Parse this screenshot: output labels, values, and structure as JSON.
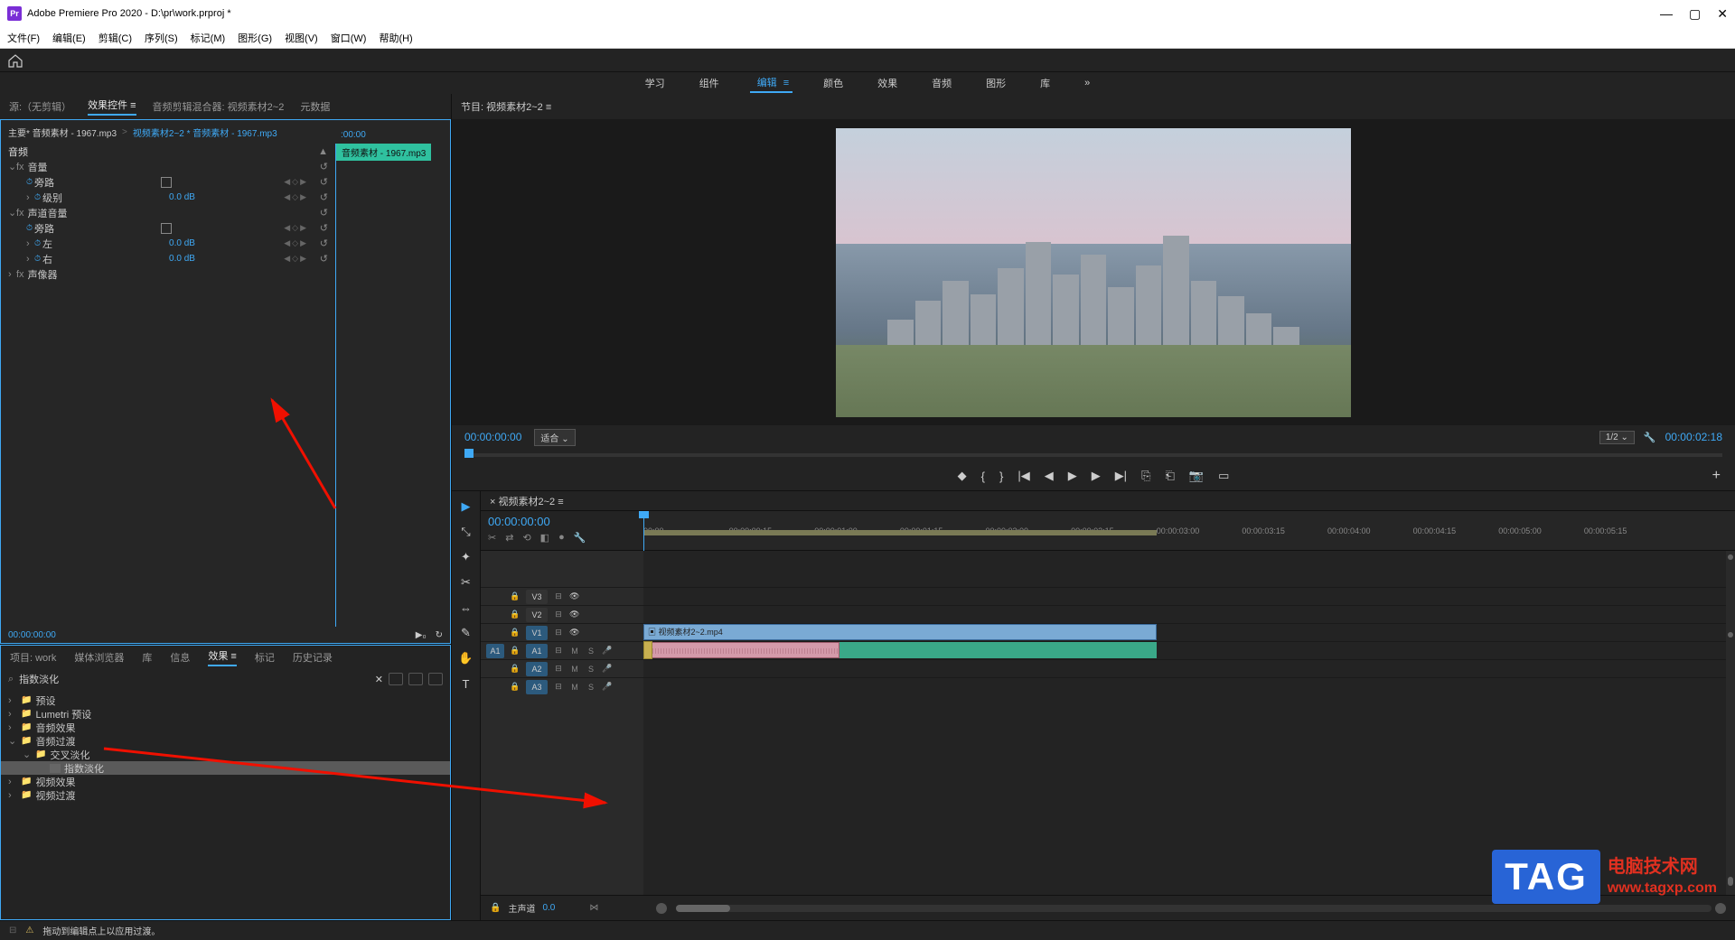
{
  "app": {
    "title": "Adobe Premiere Pro 2020 - D:\\pr\\work.prproj *"
  },
  "win_controls": {
    "min": "—",
    "max": "▢",
    "close": "✕"
  },
  "menubar": [
    "文件(F)",
    "编辑(E)",
    "剪辑(C)",
    "序列(S)",
    "标记(M)",
    "图形(G)",
    "视图(V)",
    "窗口(W)",
    "帮助(H)"
  ],
  "workspaces": {
    "items": [
      "学习",
      "组件",
      "编辑",
      "颜色",
      "效果",
      "音频",
      "图形",
      "库"
    ],
    "active": "编辑",
    "overflow": "»"
  },
  "source_tabs": {
    "items": [
      "源:（无剪辑）",
      "效果控件",
      "音频剪辑混合器: 视频素材2~2",
      "元数据"
    ],
    "active": "效果控件"
  },
  "effect_controls": {
    "master_clip": "主要* 音频素材 - 1967.mp3",
    "seq_clip": "视频素材2~2 * 音频素材 - 1967.mp3",
    "ruler_start": ":00:00",
    "chip": "音频素材 - 1967.mp3",
    "section_audio": "音频",
    "params": [
      {
        "type": "fx",
        "label": "音量",
        "reset": "↺"
      },
      {
        "type": "p",
        "label": "旁路",
        "kind": "check",
        "reset": "↺"
      },
      {
        "type": "p",
        "label": "级别",
        "value": "0.0 dB",
        "reset": "↺"
      },
      {
        "type": "fx",
        "label": "声道音量",
        "reset": "↺"
      },
      {
        "type": "p",
        "label": "旁路",
        "kind": "check",
        "reset": "↺"
      },
      {
        "type": "p",
        "label": "左",
        "value": "0.0 dB",
        "reset": "↺"
      },
      {
        "type": "p",
        "label": "右",
        "value": "0.0 dB",
        "reset": "↺"
      },
      {
        "type": "fx",
        "label": "声像器"
      }
    ],
    "footer_tc": "00:00:00:00"
  },
  "project_tabs": {
    "items": [
      "项目: work",
      "媒体浏览器",
      "库",
      "信息",
      "效果",
      "标记",
      "历史记录"
    ],
    "active": "效果"
  },
  "effects_panel": {
    "search_value": "指数淡化",
    "tree": [
      {
        "lvl": 0,
        "tw": "›",
        "icon": "folder",
        "label": "预设"
      },
      {
        "lvl": 0,
        "tw": "›",
        "icon": "folder",
        "label": "Lumetri 预设"
      },
      {
        "lvl": 0,
        "tw": "›",
        "icon": "folder",
        "label": "音频效果"
      },
      {
        "lvl": 0,
        "tw": "⌄",
        "icon": "folder",
        "label": "音频过渡"
      },
      {
        "lvl": 1,
        "tw": "⌄",
        "icon": "folder",
        "label": "交叉淡化"
      },
      {
        "lvl": 2,
        "tw": "",
        "icon": "fx",
        "label": "指数淡化",
        "sel": true
      },
      {
        "lvl": 0,
        "tw": "›",
        "icon": "folder",
        "label": "视频效果"
      },
      {
        "lvl": 0,
        "tw": "›",
        "icon": "folder",
        "label": "视频过渡"
      }
    ]
  },
  "program": {
    "header": "节目: 视频素材2~2  ≡",
    "tc_left": "00:00:00:00",
    "fit_label": "适合",
    "fit_arrow": "⌄",
    "res_label": "1/2",
    "res_arrow": "⌄",
    "tc_right": "00:00:02:18",
    "transport": {
      "mark_in": "◆",
      "in": "{",
      "out": "}",
      "goto_in": "|◀",
      "step_back": "◀",
      "play": "▶",
      "step_fwd": "▶",
      "goto_out": "▶|",
      "lift": "⎘",
      "extract": "⎗",
      "snapshot": "📷",
      "export": "▭",
      "plus": "+"
    }
  },
  "timeline": {
    "tab": "视频素材2~2  ≡",
    "tc": "00:00:00:00",
    "ctrls": [
      "✂",
      "⇄",
      "⟲",
      "◧",
      "●",
      "🔧"
    ],
    "ruler": [
      "00:00",
      "00:00:00:15",
      "00:00:01:00",
      "00:00:01:15",
      "00:00:02:00",
      "00:00:02:15",
      "00:00:03:00",
      "00:00:03:15",
      "00:00:04:00",
      "00:00:04:15",
      "00:00:05:00",
      "00:00:05:15"
    ],
    "tracks_v": [
      {
        "label": "V3"
      },
      {
        "label": "V2"
      },
      {
        "label": "V1",
        "active": true
      }
    ],
    "tracks_a": [
      {
        "src": "A1",
        "label": "A1",
        "active": true
      },
      {
        "label": "A2",
        "active": true
      },
      {
        "label": "A3",
        "active": true
      }
    ],
    "clip_v1": "视频素材2~2.mp4",
    "master_label": "主声道",
    "master_val": "0.0"
  },
  "tools": [
    "▶",
    "⤡",
    "✦",
    "✂",
    "⇔",
    "✎",
    "✋",
    "T"
  ],
  "status": {
    "warn": "⚠",
    "text": "拖动到编辑点上以应用过渡。"
  }
}
